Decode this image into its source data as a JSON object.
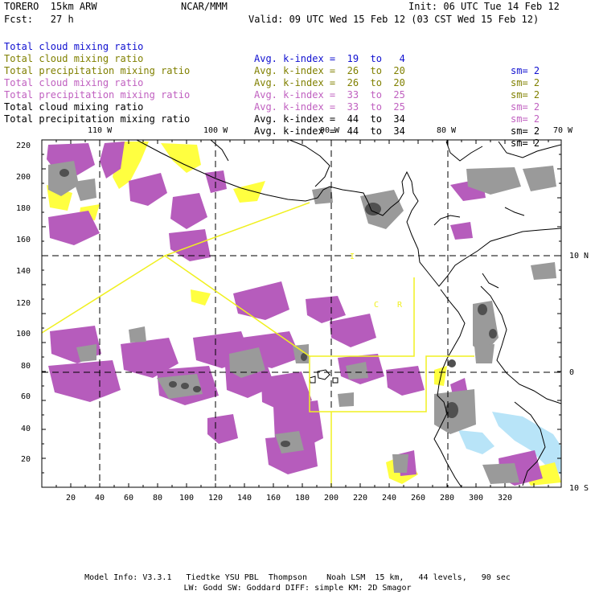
{
  "header": {
    "model": "TORERO  15km ARW",
    "center": "NCAR/MMM",
    "init": "Init: 06 UTC Tue 14 Feb 12",
    "fcst": "Fcst:   27 h",
    "valid": "Valid: 09 UTC Wed 15 Feb 12 (03 CST Wed 15 Feb 12)"
  },
  "legend_rows": [
    {
      "field": "Total cloud mixing ratio",
      "index": "Avg. k-index =  19  to   4",
      "sm": "sm= 2",
      "color": "#1010d0"
    },
    {
      "field": "Total cloud mixing ratio",
      "index": "Avg. k-index =  26  to  20",
      "sm": "sm= 2",
      "color": "#808000"
    },
    {
      "field": "Total precipitation mixing ratio",
      "index": "Avg. k-index =  26  to  20",
      "sm": "sm= 2",
      "color": "#808000"
    },
    {
      "field": "Total cloud mixing ratio",
      "index": "Avg. k-index =  33  to  25",
      "sm": "sm= 2",
      "color": "#c060c0"
    },
    {
      "field": "Total precipitation mixing ratio",
      "index": "Avg. k-index =  33  to  25",
      "sm": "sm= 2",
      "color": "#c060c0"
    },
    {
      "field": "Total cloud mixing ratio",
      "index": "Avg. k-index =  44  to  34",
      "sm": "sm= 2",
      "color": "#000000"
    },
    {
      "field": "Total precipitation mixing ratio",
      "index": "Avg. k-index =  44  to  34",
      "sm": "sm= 2",
      "color": "#000000"
    }
  ],
  "map": {
    "lon_labels": [
      "110 W",
      "100 W",
      "90 W",
      "80 W",
      "70 W"
    ],
    "lat_labels": [
      "10 N",
      "0",
      "10 S"
    ],
    "x_ticks": [
      "20",
      "40",
      "60",
      "80",
      "100",
      "120",
      "140",
      "160",
      "180",
      "200",
      "220",
      "240",
      "260",
      "280",
      "300",
      "320"
    ],
    "y_ticks": [
      "20",
      "40",
      "60",
      "80",
      "100",
      "120",
      "140",
      "160",
      "180",
      "200",
      "220"
    ],
    "region_labels": [
      "I",
      "C",
      "R"
    ],
    "colors": {
      "purple": "#b65cbc",
      "gray": "#9a9a9a",
      "darkgray": "#505050",
      "yellow": "#ffff40",
      "lightblue": "#b8e4f8",
      "domain_box": "#f0f020"
    }
  },
  "footer": {
    "line1": "Model Info: V3.3.1   Tiedtke YSU PBL  Thompson    Noah LSM  15 km,   44 levels,   90 sec",
    "line2": "LW: Godd SW: Goddard DIFF: simple KM: 2D Smagor"
  }
}
